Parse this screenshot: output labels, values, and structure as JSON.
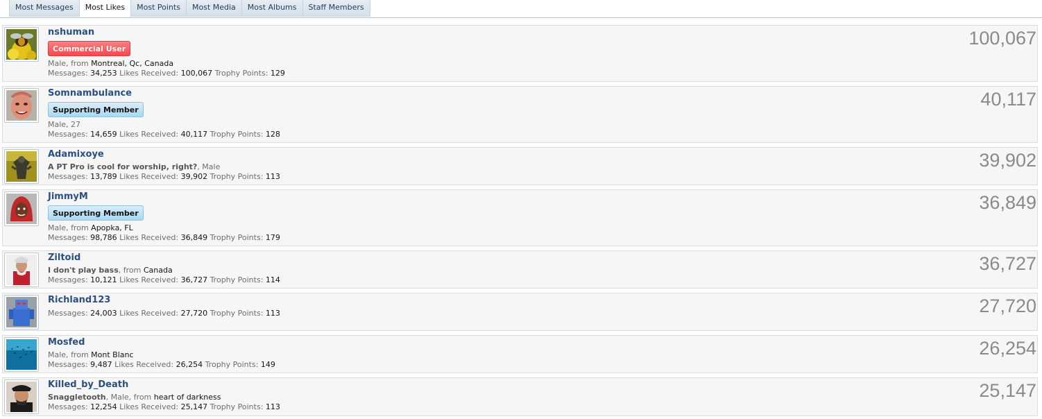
{
  "tabs": [
    {
      "label": "Most Messages",
      "active": false
    },
    {
      "label": "Most Likes",
      "active": true
    },
    {
      "label": "Most Points",
      "active": false
    },
    {
      "label": "Most Media",
      "active": false
    },
    {
      "label": "Most Albums",
      "active": false
    },
    {
      "label": "Staff Members",
      "active": false
    }
  ],
  "labels": {
    "messages": "Messages:",
    "likes": "Likes Received:",
    "trophy": "Trophy Points:",
    "from": "from"
  },
  "members": [
    {
      "username": "nshuman",
      "banner": "Commercial User",
      "banner_style": "red",
      "detail_prefix": "Male, ",
      "location": "Montreal, Qc, Canada",
      "messages": "34,253",
      "likes": "100,067",
      "trophy": "129",
      "score": "100,067",
      "avatar_icon": "bee-on-flower-icon"
    },
    {
      "username": "Somnambulance",
      "banner": "Supporting Member",
      "banner_style": "blue",
      "detail_prefix": "Male, 27",
      "location": "",
      "messages": "14,659",
      "likes": "40,117",
      "trophy": "128",
      "score": "40,117",
      "avatar_icon": "face-icon"
    },
    {
      "username": "Adamixoye",
      "banner": "",
      "custom_title": "A PT Pro is cool for worship, right?",
      "detail_prefix": ", Male",
      "location": "",
      "messages": "13,789",
      "likes": "39,902",
      "trophy": "113",
      "score": "39,902",
      "avatar_icon": "monster-figure-icon"
    },
    {
      "username": "JimmyM",
      "banner": "Supporting Member",
      "banner_style": "blue",
      "detail_prefix": "Male, ",
      "location": "Apopka, FL",
      "messages": "98,786",
      "likes": "36,849",
      "trophy": "179",
      "score": "36,849",
      "avatar_icon": "hooded-figure-icon"
    },
    {
      "username": "Ziltoid",
      "banner": "",
      "custom_title": "I don't play bass",
      "detail_prefix": ", ",
      "location": "Canada",
      "messages": "10,121",
      "likes": "36,727",
      "trophy": "114",
      "score": "36,727",
      "avatar_icon": "bearded-man-icon"
    },
    {
      "username": "Richland123",
      "banner": "",
      "detail_prefix": "",
      "location": "",
      "messages": "24,003",
      "likes": "27,720",
      "trophy": "113",
      "score": "27,720",
      "avatar_icon": "robot-toy-icon"
    },
    {
      "username": "Mosfed",
      "banner": "",
      "detail_prefix": "Male, ",
      "location": "Mont Blanc",
      "messages": "9,487",
      "likes": "26,254",
      "trophy": "149",
      "score": "26,254",
      "avatar_icon": "fish-school-icon"
    },
    {
      "username": "Killed_by_Death",
      "banner": "",
      "custom_title": "Snaggletooth",
      "detail_prefix": ", Male, ",
      "location": "heart of darkness",
      "messages": "12,254",
      "likes": "25,147",
      "trophy": "113",
      "score": "25,147",
      "avatar_icon": "rocker-man-icon"
    }
  ]
}
